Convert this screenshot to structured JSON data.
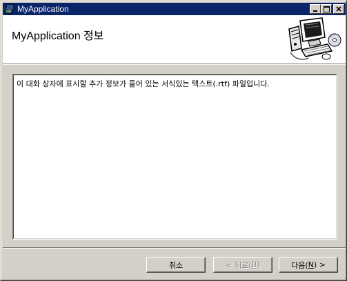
{
  "window": {
    "title": "MyApplication"
  },
  "header": {
    "title": "MyApplication 정보"
  },
  "content": {
    "text": "이 대화 상자에 표시할 추가 정보가 들어 있는 서식있는 텍스트(.rtf) 파일입니다."
  },
  "buttons": {
    "cancel": "취소",
    "back_prefix": "< 뒤로(",
    "back_key": "B",
    "back_suffix": ")",
    "next_prefix": "다음(",
    "next_key": "N",
    "next_suffix": ") >"
  },
  "icons": {
    "app": "installer-icon",
    "minimize": "minimize-icon",
    "maximize": "maximize-icon",
    "close": "close-icon",
    "header_art": "computer-setup-icon"
  },
  "colors": {
    "titlebar": "#0a246a",
    "face": "#d4d0c8",
    "header_bg": "#ffffff"
  }
}
